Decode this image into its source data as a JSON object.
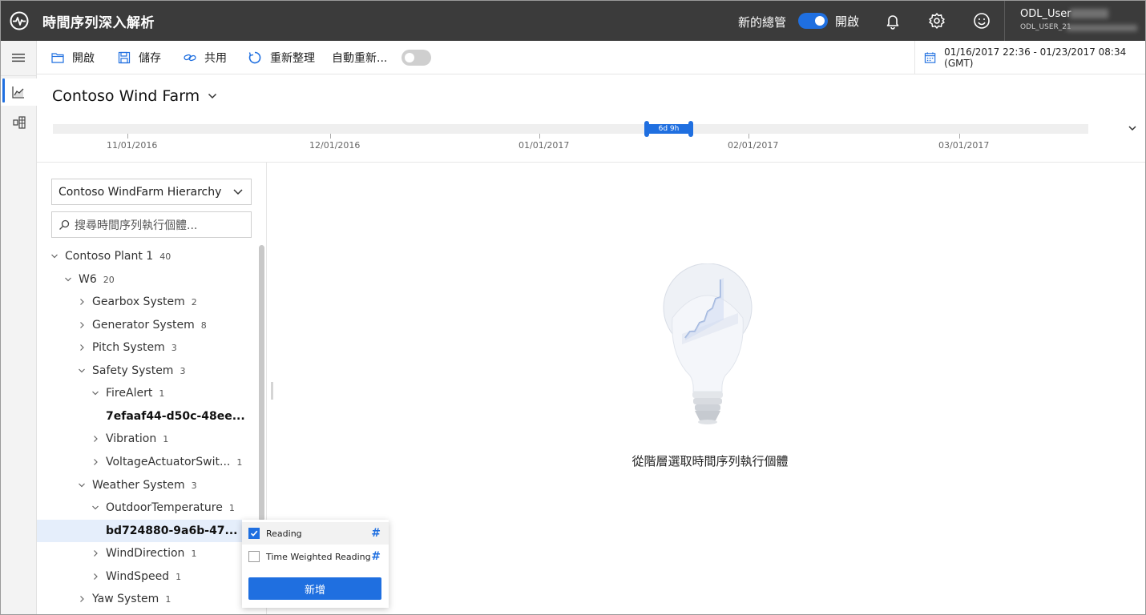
{
  "header": {
    "app_title": "時間序列深入解析",
    "new_experience_label": "新的總管",
    "new_experience_state": "開啟",
    "user_name": "ODL_User",
    "user_id": "ODL_USER_21"
  },
  "toolbar": {
    "open_label": "開啟",
    "save_label": "儲存",
    "share_label": "共用",
    "refresh_label": "重新整理",
    "auto_refresh_label": "自動重新...",
    "date_range": "01/16/2017 22:36 - 01/23/2017 08:34 (GMT)"
  },
  "environment": {
    "name": "Contoso Wind Farm"
  },
  "time_brush": {
    "selection_label": "6d 9h",
    "ticks": [
      "11/01/2016",
      "12/01/2016",
      "01/01/2017",
      "02/01/2017",
      "03/01/2017"
    ]
  },
  "hierarchy": {
    "selected": "Contoso WindFarm Hierarchy",
    "search_placeholder": "搜尋時間序列執行個體...",
    "tree": [
      {
        "label": "Contoso Plant 1",
        "count": "40"
      },
      {
        "label": "W6",
        "count": "20"
      },
      {
        "label": "Gearbox System",
        "count": "2"
      },
      {
        "label": "Generator System",
        "count": "8"
      },
      {
        "label": "Pitch System",
        "count": "3"
      },
      {
        "label": "Safety System",
        "count": "3"
      },
      {
        "label": "FireAlert",
        "count": "1"
      },
      {
        "label": "7efaaf44-d50c-48ee...",
        "count": ""
      },
      {
        "label": "Vibration",
        "count": "1"
      },
      {
        "label": "VoltageActuatorSwit...",
        "count": "1"
      },
      {
        "label": "Weather System",
        "count": "3"
      },
      {
        "label": "OutdoorTemperature",
        "count": "1"
      },
      {
        "label": "bd724880-9a6b-47...",
        "count": ""
      },
      {
        "label": "WindDirection",
        "count": "1"
      },
      {
        "label": "WindSpeed",
        "count": "1"
      },
      {
        "label": "Yaw System",
        "count": "1"
      }
    ]
  },
  "variables_popover": {
    "items": [
      {
        "label": "Reading",
        "checked": true,
        "type_symbol": "#"
      },
      {
        "label": "Time Weighted Reading",
        "checked": false,
        "type_symbol": "#"
      }
    ],
    "add_label": "新增"
  },
  "empty_state": {
    "message": "從階層選取時間序列執行個體"
  },
  "colors": {
    "header_bg": "#3b3b3b",
    "accent": "#1f6fe0",
    "rail_bg": "#f3f3f3",
    "selected_row": "#e5eefb"
  }
}
